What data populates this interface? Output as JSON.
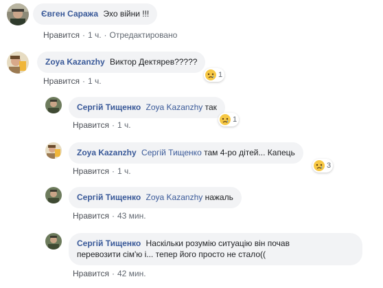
{
  "comments": [
    {
      "author": "Євген Саража",
      "text": "Эхо війни !!!",
      "like": "Нравится",
      "time": "1 ч.",
      "edited": "Отредактировано"
    },
    {
      "author": "Zoya Kazanzhy",
      "text": "Виктор Дектярев?????",
      "like": "Нравится",
      "time": "1 ч.",
      "reaction_count": "1"
    },
    {
      "author": "Сергій Тищенко",
      "mention": "Zoya Kazanzhy",
      "text": "так",
      "like": "Нравится",
      "time": "1 ч.",
      "reaction_count": "1"
    },
    {
      "author": "Zoya Kazanzhy",
      "mention": "Сергій Тищенко",
      "text": "там 4-ро дітей... Капець",
      "like": "Нравится",
      "time": "1 ч.",
      "reaction_count": "3"
    },
    {
      "author": "Сергій Тищенко",
      "mention": "Zoya Kazanzhy",
      "text": "нажаль",
      "like": "Нравится",
      "time": "43 мин."
    },
    {
      "author": "Сергій Тищенко",
      "text_line1": "Наскільки розумію ситуацію він почав",
      "text_line2": "перевозити сім'ю і... тепер його просто не стало((",
      "like": "Нравится",
      "time": "42 мин."
    }
  ],
  "colors": {
    "link": "#385898",
    "bubble": "#f2f3f5",
    "meta": "#606770"
  },
  "icons": {
    "reaction": "crying-face-reaction-icon"
  }
}
